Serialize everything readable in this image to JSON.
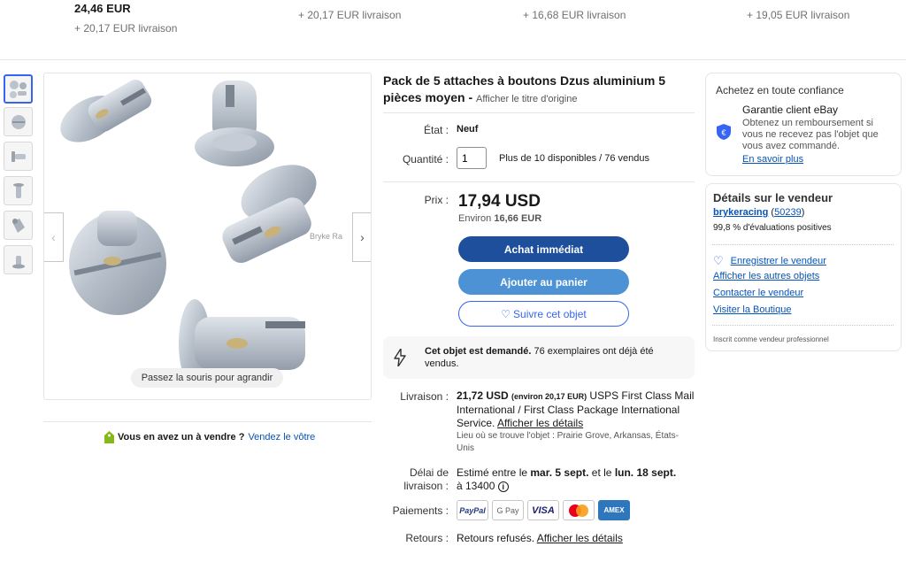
{
  "top_strip": {
    "first_price": "24,46 EUR",
    "first_shipping": "+ 20,17 EUR livraison",
    "shipping_2": "+ 20,17 EUR livraison",
    "shipping_3": "+ 16,68 EUR livraison",
    "shipping_4": "+ 19,05 EUR livraison"
  },
  "gallery": {
    "hover_hint": "Passez la souris pour agrandir",
    "watermark": "Bryke Ra",
    "sell_prompt": "Vous en avez un à vendre ?",
    "sell_link": "Vendez le vôtre"
  },
  "listing": {
    "title": "Pack de 5 attaches à boutons Dzus aluminium 5 pièces moyen -",
    "original_title_link": "Afficher le titre d'origine",
    "condition_label": "État :",
    "condition_value": "Neuf",
    "quantity_label": "Quantité :",
    "quantity_value": "1",
    "availability": "Plus de 10 disponibles / 76 vendus",
    "price_label": "Prix :",
    "price": "17,94 USD",
    "price_approx_prefix": "Environ",
    "price_approx_value": "16,66 EUR",
    "buy_now": "Achat immédiat",
    "add_to_cart": "Ajouter au panier",
    "watch": "Suivre cet objet",
    "demand_bold": "Cet objet est demandé.",
    "demand_text": "76 exemplaires ont déjà été vendus.",
    "shipping_label": "Livraison :",
    "shipping_price": "21,72 USD",
    "shipping_approx": "(environ 20,17 EUR)",
    "shipping_service": "USPS First Class Mail International / First Class Package International Service.",
    "shipping_details_link": "Afficher les détails",
    "location": "Lieu où se trouve l'objet : Prairie Grove, Arkansas, États-Unis",
    "delivery_label_1": "Délai de",
    "delivery_label_2": "livraison :",
    "delivery_prefix": "Estimé entre le",
    "delivery_from": "mar. 5 sept.",
    "delivery_and": "et le",
    "delivery_to": "lun. 18 sept.",
    "delivery_suffix": "à 13400",
    "payments_label": "Paiements :",
    "payment_methods": [
      "PayPal",
      "G Pay",
      "VISA",
      "Mastercard",
      "AMEX"
    ],
    "returns_label": "Retours :",
    "returns_text": "Retours refusés.",
    "returns_link": "Afficher les détails"
  },
  "trust_card": {
    "heading": "Achetez en toute confiance",
    "guarantee_title": "Garantie client eBay",
    "guarantee_text": "Obtenez un remboursement si vous ne recevez pas l'objet que vous avez commandé.",
    "learn_more": "En savoir plus"
  },
  "seller_card": {
    "heading": "Détails sur le vendeur",
    "seller_name": "brykeracing",
    "feedback_score": "50239",
    "positive": "99,8 % d'évaluations positives",
    "save_seller": "Enregistrer le vendeur",
    "other_items": "Afficher les autres objets",
    "contact": "Contacter le vendeur",
    "store": "Visiter la Boutique",
    "registered": "Inscrit comme vendeur professionnel"
  },
  "colors": {
    "link": "#0654ba",
    "buy_button": "#1e4f9c",
    "cart_button": "#4c92d4",
    "accent": "#3665f3"
  }
}
